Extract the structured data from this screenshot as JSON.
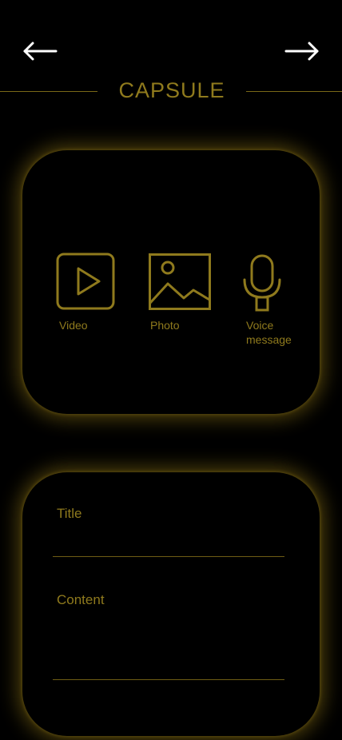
{
  "header": {
    "back_icon": "arrow-left-icon",
    "forward_icon": "arrow-right-icon",
    "title": "CAPSULE"
  },
  "media_options": {
    "video": {
      "label": "Video",
      "icon": "video-play-icon"
    },
    "photo": {
      "label": "Photo",
      "icon": "photo-image-icon"
    },
    "voice": {
      "label": "Voice\nmessage",
      "icon": "microphone-icon"
    }
  },
  "form": {
    "title_label": "Title",
    "title_value": "",
    "content_label": "Content",
    "content_value": ""
  },
  "colors": {
    "background": "#000000",
    "accent": "#8f7a1d",
    "arrow": "#ffffff",
    "glow": "#8c7314"
  }
}
